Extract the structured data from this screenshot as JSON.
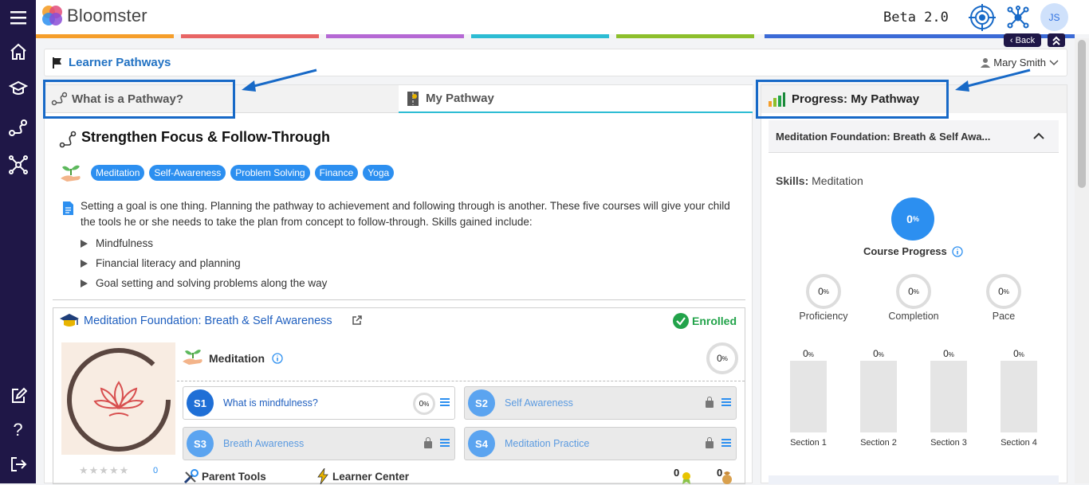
{
  "app": {
    "name": "Bloomster",
    "beta": "Beta 2.0",
    "avatar_initials": "JS",
    "back_label": "Back"
  },
  "colors": {
    "sidebar": "#1f1747",
    "accent": "#2272c3",
    "tag": "#2c8ff0",
    "enrolled": "#22a34a",
    "stripes": [
      "#f59e2a",
      "#e86565",
      "#b568d4",
      "#2cbcd3",
      "#8dbf2c",
      "#3b6ad6"
    ]
  },
  "header": {
    "title": "Learner Pathways",
    "user": "Mary Smith"
  },
  "tabs": {
    "what": "What is a Pathway?",
    "my": "My Pathway",
    "progress": "Progress: My Pathway"
  },
  "pathway": {
    "title": "Strengthen Focus & Follow-Through",
    "tags": [
      "Meditation",
      "Self-Awareness",
      "Problem Solving",
      "Finance",
      "Yoga"
    ],
    "description": "Setting a goal is one thing. Planning the pathway to achievement and following through is another. These five courses will give your child the tools he or she needs to take the plan from concept to follow-through. Skills gained include:",
    "bullets": [
      "Mindfulness",
      "Financial literacy and planning",
      "Goal setting and solving problems along the way"
    ]
  },
  "course": {
    "title": "Meditation Foundation: Breath & Self Awareness",
    "status": "Enrolled",
    "skill": "Meditation",
    "skill_progress": "0",
    "rating_count": "0",
    "sections": [
      {
        "code": "S1",
        "label": "What is mindfulness?",
        "progress": "0",
        "locked": false
      },
      {
        "code": "S2",
        "label": "Self Awareness",
        "locked": true
      },
      {
        "code": "S3",
        "label": "Breath Awareness",
        "locked": true
      },
      {
        "code": "S4",
        "label": "Meditation Practice",
        "locked": true
      }
    ],
    "parent_tools": "Parent Tools",
    "learner_center": "Learner Center",
    "badge_a": "0",
    "badge_b": "0"
  },
  "progress": {
    "course_title": "Meditation Foundation: Breath & Self Awa...",
    "skills_label": "Skills:",
    "skills_value": "Meditation",
    "course_progress": "0",
    "course_progress_label": "Course Progress",
    "metrics": [
      {
        "label": "Proficiency",
        "value": "0"
      },
      {
        "label": "Completion",
        "value": "0"
      },
      {
        "label": "Pace",
        "value": "0"
      }
    ],
    "sections": [
      {
        "label": "Section 1",
        "value": "0"
      },
      {
        "label": "Section 2",
        "value": "0"
      },
      {
        "label": "Section 3",
        "value": "0"
      },
      {
        "label": "Section 4",
        "value": "0"
      }
    ],
    "pct": "%"
  }
}
